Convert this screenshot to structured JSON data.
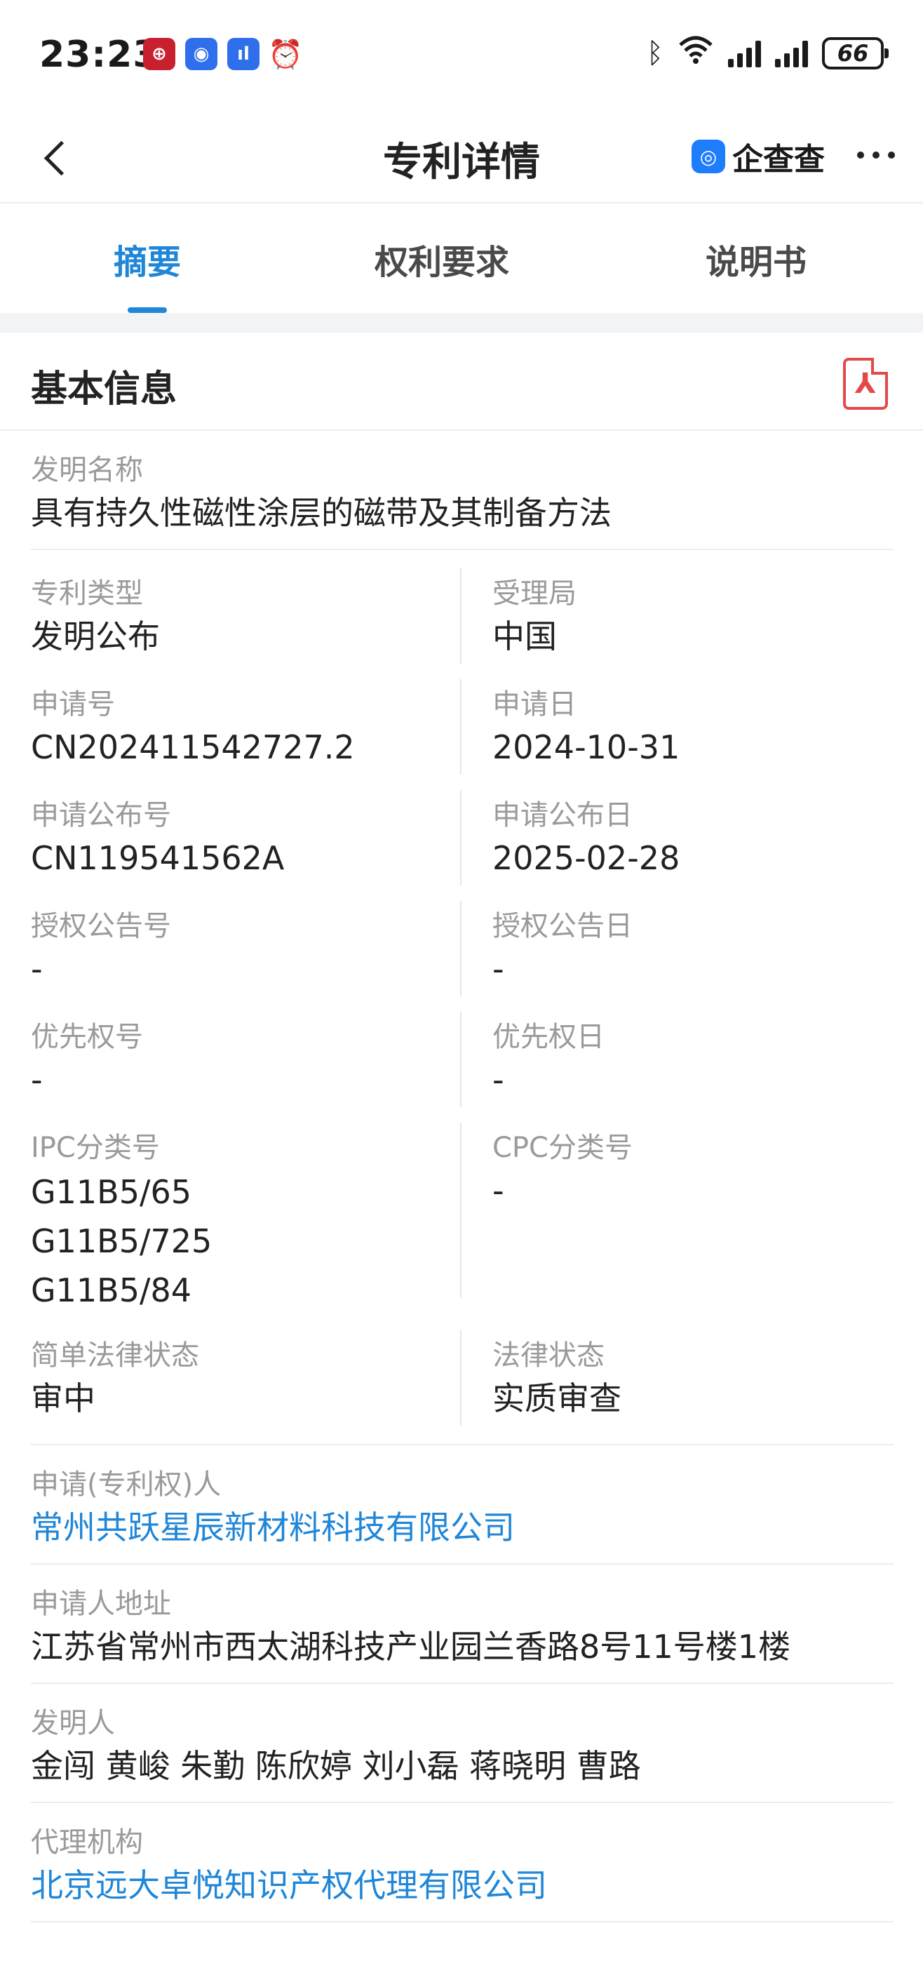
{
  "status_bar": {
    "time": "23:23",
    "battery": "66",
    "icons": [
      "bank-app-icon",
      "blue-app-icon",
      "voice-app-icon",
      "alarm-icon",
      "bluetooth-icon",
      "wifi-icon",
      "signal-icon",
      "signal-icon"
    ]
  },
  "header": {
    "title": "专利详情",
    "brand_name": "企查查"
  },
  "tabs": [
    {
      "label": "摘要",
      "active": true
    },
    {
      "label": "权利要求",
      "active": false
    },
    {
      "label": "说明书",
      "active": false
    }
  ],
  "section": {
    "title": "基本信息"
  },
  "fields": {
    "invention_name": {
      "label": "发明名称",
      "value": "具有持久性磁性涂层的磁带及其制备方法"
    },
    "patent_type": {
      "label": "专利类型",
      "value": "发明公布"
    },
    "office": {
      "label": "受理局",
      "value": "中国"
    },
    "app_no": {
      "label": "申请号",
      "value": "CN202411542727.2"
    },
    "app_date": {
      "label": "申请日",
      "value": "2024-10-31"
    },
    "pub_no": {
      "label": "申请公布号",
      "value": "CN119541562A"
    },
    "pub_date": {
      "label": "申请公布日",
      "value": "2025-02-28"
    },
    "grant_no": {
      "label": "授权公告号",
      "value": "-"
    },
    "grant_date": {
      "label": "授权公告日",
      "value": "-"
    },
    "priority_no": {
      "label": "优先权号",
      "value": "-"
    },
    "priority_date": {
      "label": "优先权日",
      "value": "-"
    },
    "ipc": {
      "label": "IPC分类号",
      "values": [
        "G11B5/65",
        "G11B5/725",
        "G11B5/84"
      ]
    },
    "cpc": {
      "label": "CPC分类号",
      "value": "-"
    },
    "simple_legal_status": {
      "label": "简单法律状态",
      "value": "审中"
    },
    "legal_status": {
      "label": "法律状态",
      "value": "实质审查"
    },
    "applicant": {
      "label": "申请(专利权)人",
      "value": "常州共跃星辰新材料科技有限公司"
    },
    "applicant_address": {
      "label": "申请人地址",
      "value": "江苏省常州市西太湖科技产业园兰香路8号11号楼1楼"
    },
    "inventors": {
      "label": "发明人",
      "value": "金闯 黄峻 朱勤 陈欣婷 刘小磊 蒋晓明 曹路"
    },
    "agency": {
      "label": "代理机构",
      "value": "北京远大卓悦知识产权代理有限公司"
    }
  }
}
